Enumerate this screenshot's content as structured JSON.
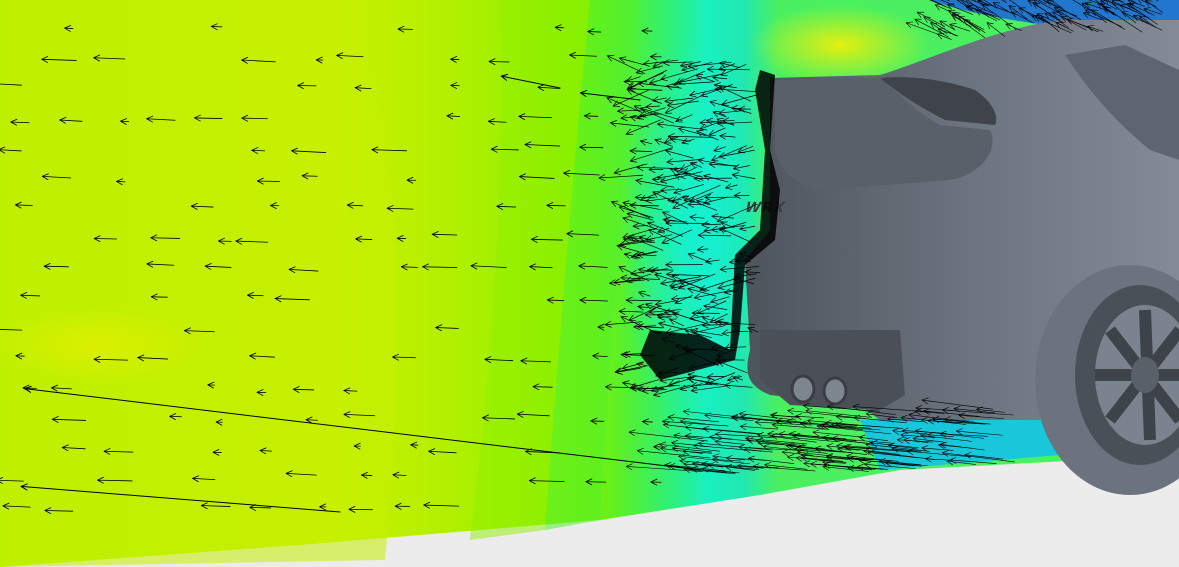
{
  "scene": {
    "subject": "car-rear-aerodynamic-flow",
    "badge_text": "WRX",
    "colors": {
      "floor": "#ececec",
      "field_far": "#c8f000",
      "field_mid": "#9cf000",
      "field_near": "#35f048",
      "field_wake": "#19f0c0",
      "field_top": "#ffe800",
      "field_under": "#10b8f0",
      "body_dark": "#4f555e",
      "body_mid": "#6b747f",
      "body_light": "#8a939e",
      "vector": "#000000"
    }
  }
}
